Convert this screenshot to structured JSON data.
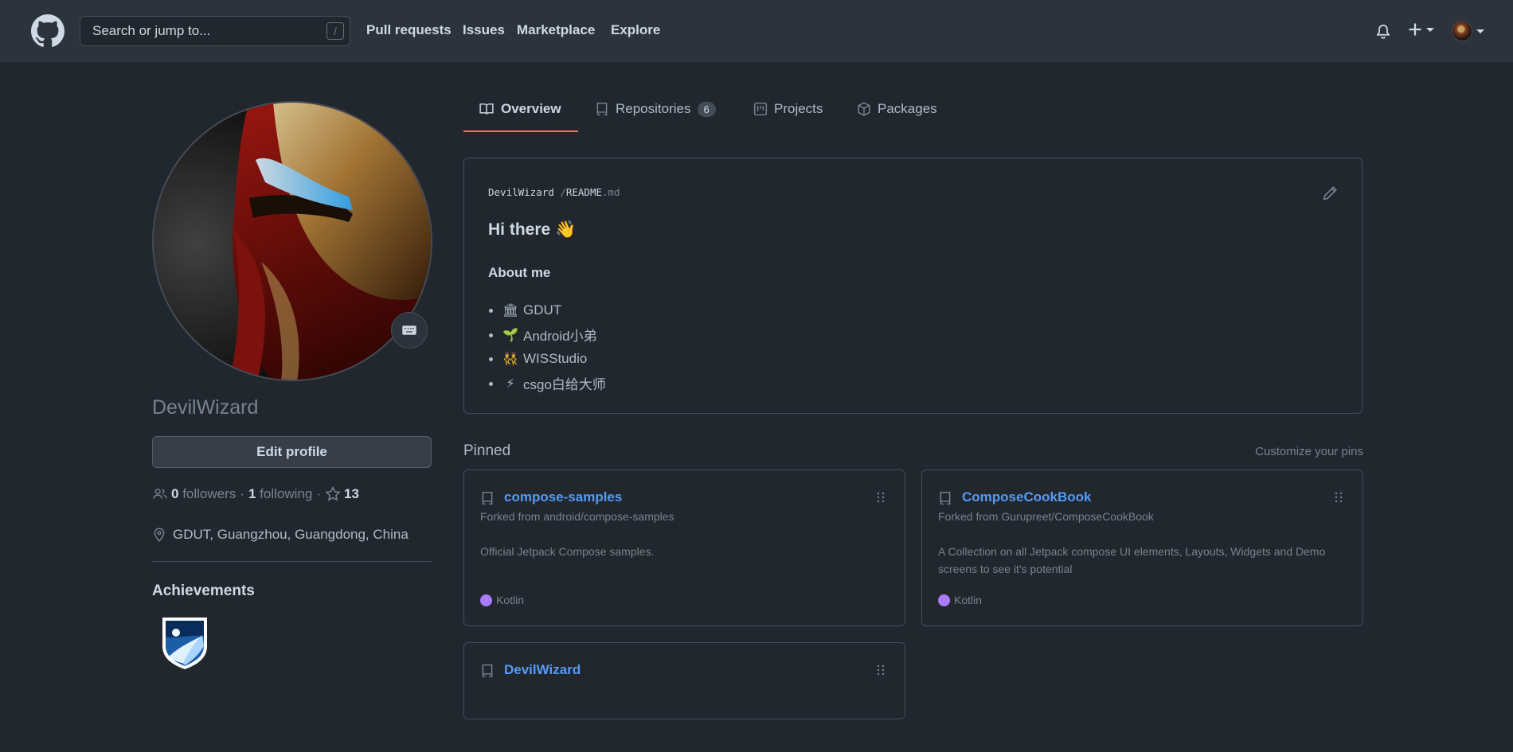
{
  "header": {
    "search_placeholder": "Search or jump to...",
    "search_shortcut": "/",
    "nav": [
      "Pull requests",
      "Issues",
      "Marketplace",
      "Explore"
    ]
  },
  "profile": {
    "username": "DevilWizard",
    "edit_button": "Edit profile",
    "followers_count": "0",
    "followers_label": "followers",
    "following_count": "1",
    "following_label": "following",
    "stars_count": "13",
    "location": "GDUT, Guangzhou, Guangdong, China",
    "achievements_title": "Achievements"
  },
  "tabs": [
    {
      "label": "Overview",
      "icon": "book-icon",
      "active": true
    },
    {
      "label": "Repositories",
      "icon": "repo-icon",
      "counter": "6"
    },
    {
      "label": "Projects",
      "icon": "project-icon"
    },
    {
      "label": "Packages",
      "icon": "package-icon"
    }
  ],
  "readme": {
    "owner": "DevilWizard",
    "sep": "/",
    "file_name": "README",
    "file_ext": ".md",
    "heading": "Hi there 👋",
    "subheading": "About me",
    "items": [
      {
        "emoji": "🏛",
        "text": "GDUT"
      },
      {
        "emoji": "🌱",
        "text": "Android小弟"
      },
      {
        "emoji": "👯",
        "text": "WISStudio"
      },
      {
        "emoji": "⚡",
        "text": "csgo白给大师"
      }
    ]
  },
  "pinned": {
    "title": "Pinned",
    "customize": "Customize your pins",
    "repos": [
      {
        "name": "compose-samples",
        "fork": "Forked from android/compose-samples",
        "desc": "Official Jetpack Compose samples.",
        "lang": "Kotlin",
        "lang_color": "#A97BFF"
      },
      {
        "name": "ComposeCookBook",
        "fork": "Forked from Gurupreet/ComposeCookBook",
        "desc": "A Collection on all Jetpack compose UI elements, Layouts, Widgets and Demo screens to see it's potential",
        "lang": "Kotlin",
        "lang_color": "#A97BFF"
      },
      {
        "name": "DevilWizard"
      }
    ]
  },
  "colors": {
    "bg": "#22272e",
    "header_bg": "#2d333b",
    "accent_tab": "#ec775c",
    "link": "#539bf5"
  }
}
